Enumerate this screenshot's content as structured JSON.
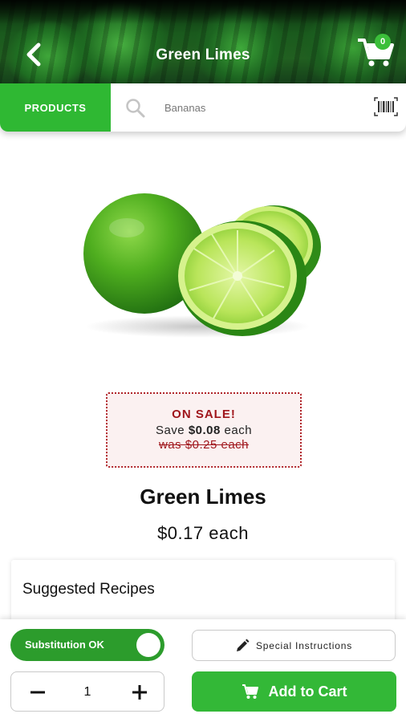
{
  "header": {
    "title": "Green Limes",
    "cart_count": "0",
    "back_icon": "chevron-left-icon",
    "cart_icon": "shopping-cart-icon"
  },
  "search": {
    "tab_label": "PRODUCTS",
    "placeholder": "Bananas",
    "search_icon": "search-icon",
    "barcode_icon": "barcode-icon"
  },
  "product": {
    "name": "Green Limes",
    "price": "$0.17 each",
    "sale": {
      "title": "ON SALE!",
      "save_prefix": "Save",
      "save_amount": "$0.08",
      "save_suffix": "each",
      "was": "was $0.25 each"
    }
  },
  "recipes": {
    "title": "Suggested Recipes"
  },
  "bottom": {
    "substitution_label": "Substitution OK",
    "substitution_on": true,
    "special_instructions_label": "Special Instructions",
    "quantity": "1",
    "add_to_cart_label": "Add to Cart"
  },
  "colors": {
    "primary_green": "#33b837",
    "toggle_green": "#2c9c2c",
    "sale_red": "#a0161c"
  }
}
